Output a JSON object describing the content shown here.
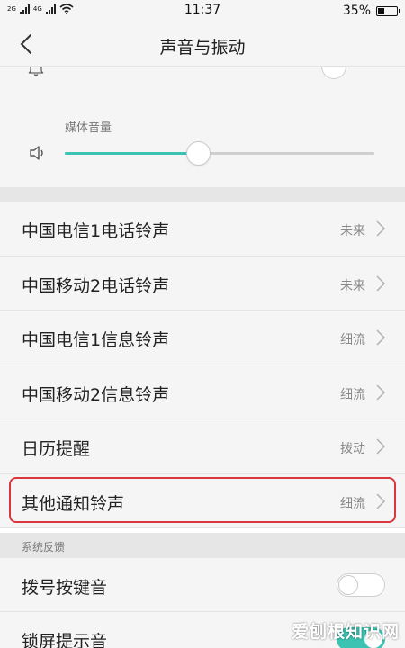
{
  "status_bar": {
    "signal_1_label": "2G",
    "signal_2_label": "4G",
    "time": "11:37",
    "battery_text": "35%",
    "battery_level": 0.35
  },
  "nav": {
    "title": "声音与振动"
  },
  "volume": {
    "media_label": "媒体音量",
    "media_level": 0.43
  },
  "ringtones": [
    {
      "label": "中国电信1电话铃声",
      "value": "未来"
    },
    {
      "label": "中国移动2电话铃声",
      "value": "未来"
    },
    {
      "label": "中国电信1信息铃声",
      "value": "细流"
    },
    {
      "label": "中国移动2信息铃声",
      "value": "细流"
    },
    {
      "label": "日历提醒",
      "value": "拨动"
    },
    {
      "label": "其他通知铃声",
      "value": "细流"
    }
  ],
  "system_feedback": {
    "header": "系统反馈",
    "items": [
      {
        "label": "拨号按键音",
        "enabled": false
      },
      {
        "label": "锁屏提示音",
        "enabled": true
      }
    ]
  },
  "watermark": "爱刨根知识网",
  "colors": {
    "accent": "#3cc3b2",
    "highlight": "#d9363e"
  }
}
